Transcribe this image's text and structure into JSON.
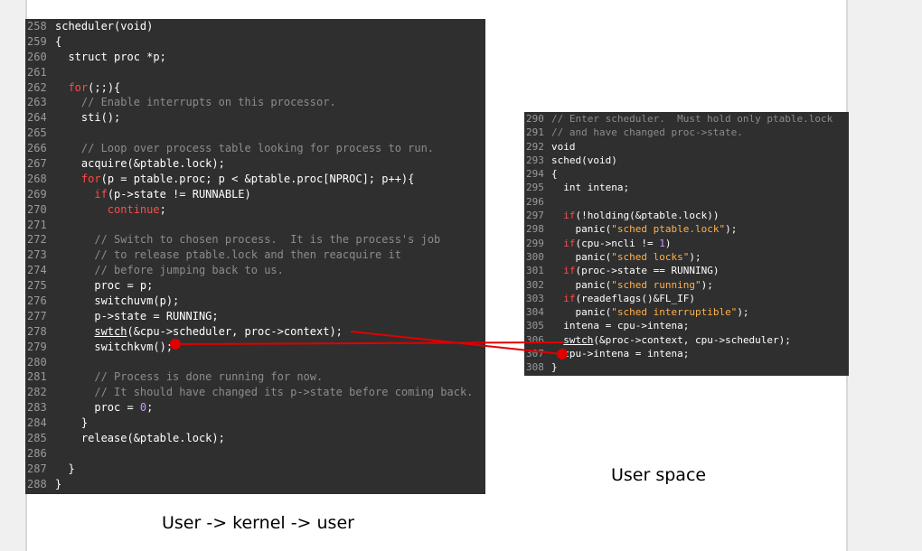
{
  "left_listing": {
    "lines": [
      {
        "num": "258",
        "tokens": [
          {
            "t": "scheduler(void)"
          }
        ]
      },
      {
        "num": "259",
        "tokens": [
          {
            "t": "{"
          }
        ]
      },
      {
        "num": "260",
        "tokens": [
          {
            "t": "  struct proc *p;"
          }
        ]
      },
      {
        "num": "261",
        "tokens": []
      },
      {
        "num": "262",
        "tokens": [
          {
            "t": "  "
          },
          {
            "t": "for",
            "c": "kw"
          },
          {
            "t": "(;;){"
          }
        ]
      },
      {
        "num": "263",
        "tokens": [
          {
            "t": "    "
          },
          {
            "t": "// Enable interrupts on this processor.",
            "c": "cm"
          }
        ]
      },
      {
        "num": "264",
        "tokens": [
          {
            "t": "    sti();"
          }
        ]
      },
      {
        "num": "265",
        "tokens": []
      },
      {
        "num": "266",
        "tokens": [
          {
            "t": "    "
          },
          {
            "t": "// Loop over process table looking for process to run.",
            "c": "cm"
          }
        ]
      },
      {
        "num": "267",
        "tokens": [
          {
            "t": "    acquire(&ptable.lock);"
          }
        ]
      },
      {
        "num": "268",
        "tokens": [
          {
            "t": "    "
          },
          {
            "t": "for",
            "c": "kw"
          },
          {
            "t": "(p = ptable.proc; p < &ptable.proc[NPROC]; p++){"
          }
        ]
      },
      {
        "num": "269",
        "tokens": [
          {
            "t": "      "
          },
          {
            "t": "if",
            "c": "kw"
          },
          {
            "t": "(p->state != RUNNABLE)"
          }
        ]
      },
      {
        "num": "270",
        "tokens": [
          {
            "t": "        "
          },
          {
            "t": "continue",
            "c": "kw"
          },
          {
            "t": ";"
          }
        ]
      },
      {
        "num": "271",
        "tokens": []
      },
      {
        "num": "272",
        "tokens": [
          {
            "t": "      "
          },
          {
            "t": "// Switch to chosen process.  It is the process's job",
            "c": "cm"
          }
        ]
      },
      {
        "num": "273",
        "tokens": [
          {
            "t": "      "
          },
          {
            "t": "// to release ptable.lock and then reacquire it",
            "c": "cm"
          }
        ]
      },
      {
        "num": "274",
        "tokens": [
          {
            "t": "      "
          },
          {
            "t": "// before jumping back to us.",
            "c": "cm"
          }
        ]
      },
      {
        "num": "275",
        "tokens": [
          {
            "t": "      proc = p;"
          }
        ]
      },
      {
        "num": "276",
        "tokens": [
          {
            "t": "      switchuvm(p);"
          }
        ]
      },
      {
        "num": "277",
        "tokens": [
          {
            "t": "      p->state = RUNNING;"
          }
        ]
      },
      {
        "num": "278",
        "tokens": [
          {
            "t": "      "
          },
          {
            "t": "swtch",
            "c": "ul"
          },
          {
            "t": "(&cpu->scheduler, proc->context);"
          }
        ]
      },
      {
        "num": "279",
        "tokens": [
          {
            "t": "      switchkvm();"
          }
        ]
      },
      {
        "num": "280",
        "tokens": []
      },
      {
        "num": "281",
        "tokens": [
          {
            "t": "      "
          },
          {
            "t": "// Process is done running for now.",
            "c": "cm"
          }
        ]
      },
      {
        "num": "282",
        "tokens": [
          {
            "t": "      "
          },
          {
            "t": "// It should have changed its p->state before coming back.",
            "c": "cm"
          }
        ]
      },
      {
        "num": "283",
        "tokens": [
          {
            "t": "      proc = "
          },
          {
            "t": "0",
            "c": "nu"
          },
          {
            "t": ";"
          }
        ]
      },
      {
        "num": "284",
        "tokens": [
          {
            "t": "    }"
          }
        ]
      },
      {
        "num": "285",
        "tokens": [
          {
            "t": "    release(&ptable.lock);"
          }
        ]
      },
      {
        "num": "286",
        "tokens": []
      },
      {
        "num": "287",
        "tokens": [
          {
            "t": "  }"
          }
        ]
      },
      {
        "num": "288",
        "tokens": [
          {
            "t": "}"
          }
        ]
      }
    ]
  },
  "right_listing": {
    "lines": [
      {
        "num": "290",
        "tokens": [
          {
            "t": "// Enter scheduler.  Must hold only ptable.lock",
            "c": "cm"
          }
        ]
      },
      {
        "num": "291",
        "tokens": [
          {
            "t": "// and have changed proc->state.",
            "c": "cm"
          }
        ]
      },
      {
        "num": "292",
        "tokens": [
          {
            "t": "void"
          }
        ]
      },
      {
        "num": "293",
        "tokens": [
          {
            "t": "sched(void)"
          }
        ]
      },
      {
        "num": "294",
        "tokens": [
          {
            "t": "{"
          }
        ]
      },
      {
        "num": "295",
        "tokens": [
          {
            "t": "  int intena;"
          }
        ]
      },
      {
        "num": "296",
        "tokens": []
      },
      {
        "num": "297",
        "tokens": [
          {
            "t": "  "
          },
          {
            "t": "if",
            "c": "kw"
          },
          {
            "t": "(!holding(&ptable.lock))"
          }
        ]
      },
      {
        "num": "298",
        "tokens": [
          {
            "t": "    panic("
          },
          {
            "t": "\"sched ptable.lock\"",
            "c": "st"
          },
          {
            "t": ");"
          }
        ]
      },
      {
        "num": "299",
        "tokens": [
          {
            "t": "  "
          },
          {
            "t": "if",
            "c": "kw"
          },
          {
            "t": "(cpu->ncli != "
          },
          {
            "t": "1",
            "c": "nu"
          },
          {
            "t": ")"
          }
        ]
      },
      {
        "num": "300",
        "tokens": [
          {
            "t": "    panic("
          },
          {
            "t": "\"sched locks\"",
            "c": "st"
          },
          {
            "t": ");"
          }
        ]
      },
      {
        "num": "301",
        "tokens": [
          {
            "t": "  "
          },
          {
            "t": "if",
            "c": "kw"
          },
          {
            "t": "(proc->state == RUNNING)"
          }
        ]
      },
      {
        "num": "302",
        "tokens": [
          {
            "t": "    panic("
          },
          {
            "t": "\"sched running\"",
            "c": "st"
          },
          {
            "t": ");"
          }
        ]
      },
      {
        "num": "303",
        "tokens": [
          {
            "t": "  "
          },
          {
            "t": "if",
            "c": "kw"
          },
          {
            "t": "(readeflags()&FL_IF)"
          }
        ]
      },
      {
        "num": "304",
        "tokens": [
          {
            "t": "    panic("
          },
          {
            "t": "\"sched interruptible\"",
            "c": "st"
          },
          {
            "t": ");"
          }
        ]
      },
      {
        "num": "305",
        "tokens": [
          {
            "t": "  intena = cpu->intena;"
          }
        ]
      },
      {
        "num": "306",
        "tokens": [
          {
            "t": "  "
          },
          {
            "t": "swtch",
            "c": "ul"
          },
          {
            "t": "(&proc->context, cpu->scheduler);"
          }
        ]
      },
      {
        "num": "307",
        "tokens": [
          {
            "t": "  cpu->intena = intena;"
          }
        ]
      },
      {
        "num": "308",
        "tokens": [
          {
            "t": "}"
          }
        ]
      }
    ]
  },
  "captions": {
    "left": "User -> kernel -> user",
    "right": "User space"
  },
  "colors": {
    "code_background": "#2f2f2f",
    "keyword": "#ff4a4a",
    "comment": "#8c8c8c",
    "string": "#ffb14a",
    "number": "#c996ff",
    "arrow": "#e00000"
  }
}
